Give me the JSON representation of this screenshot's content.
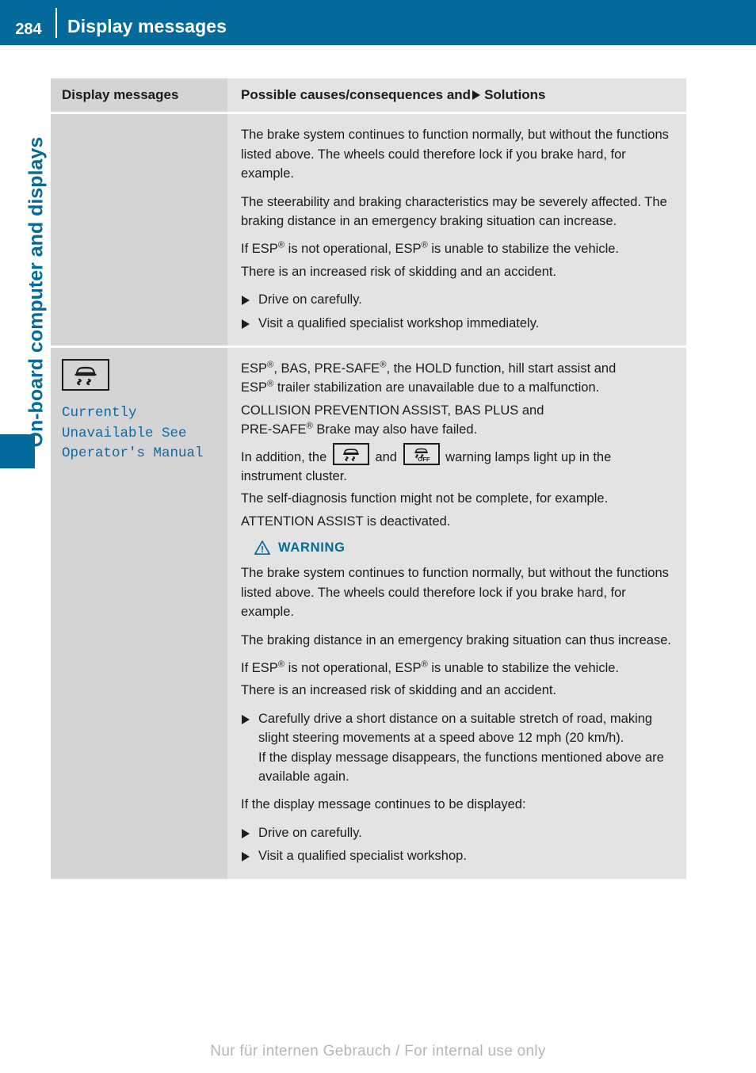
{
  "header": {
    "page_number": "284",
    "title": "Display messages"
  },
  "side_tab": {
    "chapter_label": "On-board computer and displays"
  },
  "table": {
    "columns": {
      "left_header": "Display messages",
      "right_header_before": "Possible causes/consequences and",
      "right_header_after": "Solutions"
    },
    "rows": [
      {
        "left": {
          "icon": null,
          "message": null
        },
        "right": {
          "paragraphs": [
            "The brake system continues to function normally, but without the functions listed above. The wheels could therefore lock if you brake hard, for example.",
            "The steerability and braking characteristics may be severely affected. The braking distance in an emergency braking situation can increase."
          ],
          "esp_line_1_a": "If ESP",
          "esp_line_1_b": " is not operational, ESP",
          "esp_line_1_c": " is unable to stabilize the vehicle.",
          "esp_line_2": "There is an increased risk of skidding and an accident.",
          "bullets": [
            "Drive on carefully.",
            "Visit a qualified specialist workshop immediately."
          ]
        }
      },
      {
        "left": {
          "icon": "esp-car-skid-icon",
          "message": "Currently\nUnavailable See\nOperator's Manual"
        },
        "right": {
          "intro_a": "ESP",
          "intro_b": ", BAS, PRE-SAFE",
          "intro_c": ", the HOLD function, hill start assist and",
          "intro_d": "ESP",
          "intro_e": " trailer stabilization are unavailable due to a malfunction.",
          "collision_line": "COLLISION PREVENTION ASSIST, BAS PLUS and",
          "presafe_a": "PRE-SAFE",
          "presafe_b": " Brake may also have failed.",
          "lamps_a": "In addition, the",
          "lamps_b": "and",
          "lamps_c": "warning lamps light up in the",
          "lamps_d": "instrument cluster.",
          "selfdiag": "The self-diagnosis function might not be complete, for example.",
          "attention": "ATTENTION ASSIST is deactivated.",
          "warning": {
            "label": "WARNING",
            "paragraphs": [
              "The brake system continues to function normally, but without the functions listed above. The wheels could therefore lock if you brake hard, for example.",
              "The braking distance in an emergency braking situation can thus increase."
            ],
            "esp_line_1_a": "If ESP",
            "esp_line_1_b": " is not operational, ESP",
            "esp_line_1_c": " is unable to stabilize the vehicle.",
            "esp_line_2": "There is an increased risk of skidding and an accident."
          },
          "bullet_long_main": "Carefully drive a short distance on a suitable stretch of road, making slight steering movements at a speed above 12 mph (20 km/h).",
          "bullet_long_sub": "If the display message disappears, the functions mentioned above are available again.",
          "continues_line": "If the display message continues to be displayed:",
          "bullets_end": [
            "Drive on carefully.",
            "Visit a qualified specialist workshop."
          ]
        }
      }
    ]
  },
  "footer": {
    "watermark": "Nur für internen Gebrauch / For internal use only"
  },
  "colors": {
    "brand_blue": "#046a9c",
    "message_blue": "#1268a0",
    "cell_left_gray": "#d4d4d4",
    "cell_right_gray": "#e3e3e3",
    "text_dark": "#1c1c1c"
  },
  "symbols": {
    "registered": "®",
    "solutions_triangle": "solid-right-triangle",
    "warning_triangle": "warning-triangle-icon"
  }
}
